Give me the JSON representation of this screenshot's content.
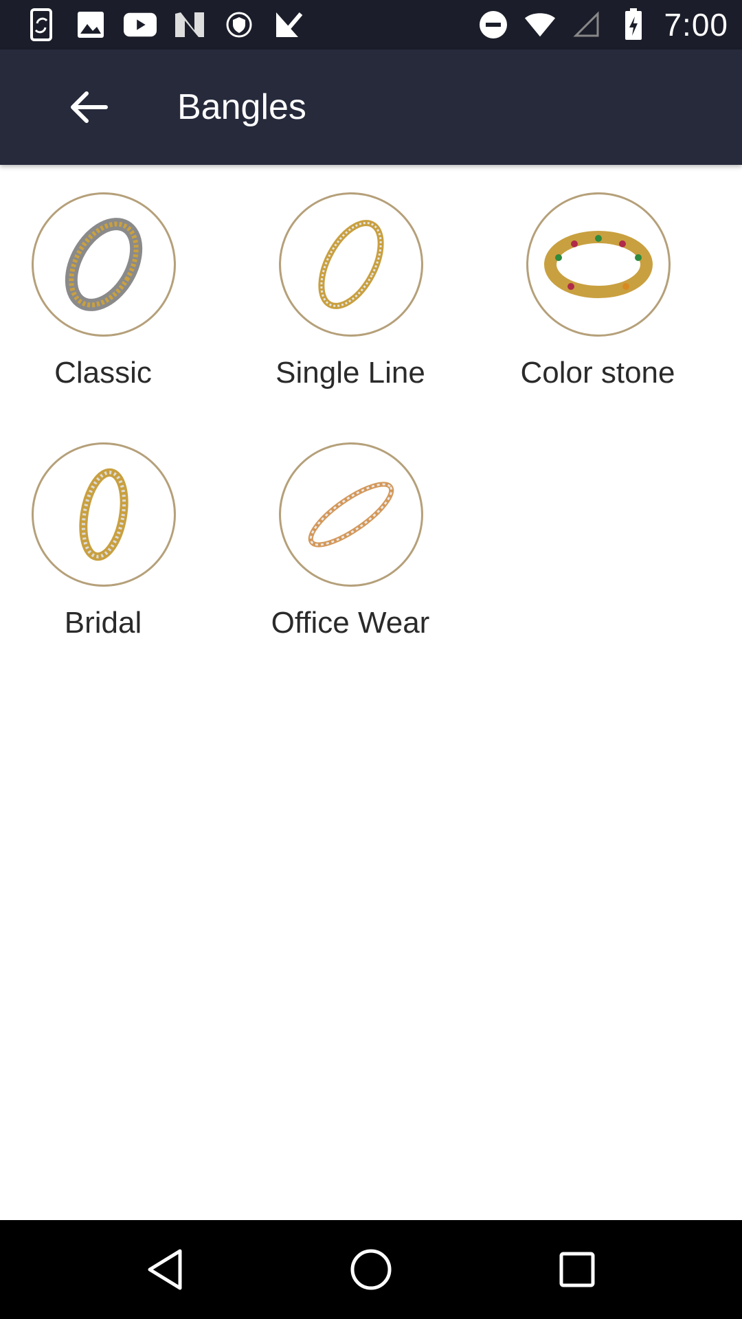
{
  "status_bar": {
    "time": "7:00",
    "left_icons": [
      "phone-sync-icon",
      "image-icon",
      "youtube-icon",
      "n-app-icon",
      "shield-icon",
      "check-icon"
    ],
    "right_icons": [
      "do-not-disturb-icon",
      "wifi-icon",
      "signal-icon",
      "battery-icon"
    ]
  },
  "app_bar": {
    "title": "Bangles",
    "background": "#262a3b"
  },
  "categories": [
    {
      "label": "Classic",
      "icon": "classic-bangle-image"
    },
    {
      "label": "Single Line",
      "icon": "single-line-bangle-image"
    },
    {
      "label": "Color stone",
      "icon": "color-stone-bangle-image"
    },
    {
      "label": "Bridal",
      "icon": "bridal-bangle-image"
    },
    {
      "label": "Office Wear",
      "icon": "office-wear-bangle-image"
    }
  ],
  "colors": {
    "status_bar": "#1b1e2a",
    "circle_border": "#b5a07a",
    "gold": "#c9a040"
  },
  "nav_bar": {
    "buttons": [
      "back-triangle-icon",
      "home-circle-icon",
      "recents-square-icon"
    ]
  }
}
